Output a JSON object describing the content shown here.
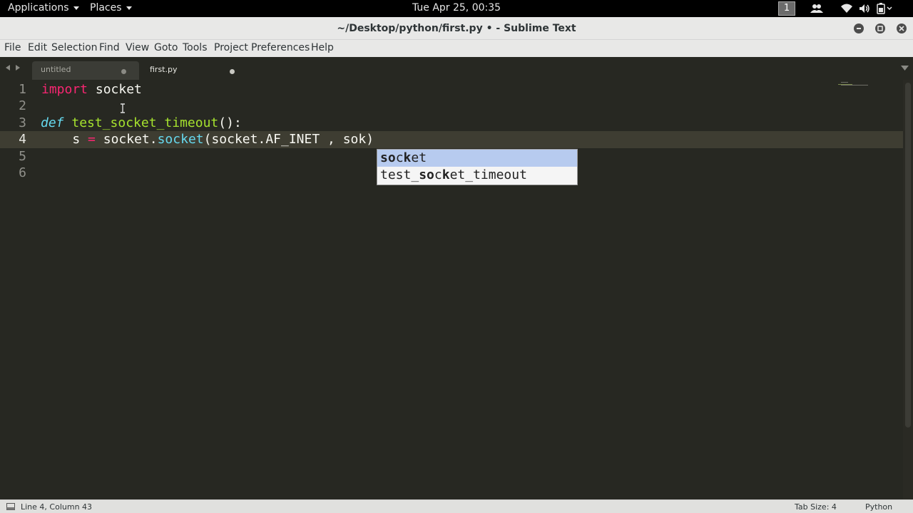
{
  "topbar": {
    "applications_label": "Applications",
    "places_label": "Places",
    "clock": "Tue Apr 25, 00:35",
    "workspace_number": "1"
  },
  "window": {
    "title": "~/Desktop/python/first.py • - Sublime Text"
  },
  "menu": {
    "items": [
      "File",
      "Edit",
      "Selection",
      "Find",
      "View",
      "Goto",
      "Tools",
      "Project",
      "Preferences",
      "Help"
    ]
  },
  "tabs": [
    {
      "label": "untitled",
      "active": false
    },
    {
      "label": "first.py",
      "active": true
    }
  ],
  "editor": {
    "line_numbers": [
      "1",
      "2",
      "3",
      "4",
      "5",
      "6"
    ],
    "active_line": 4,
    "line1": {
      "keyword": "import",
      "rest": " socket"
    },
    "line3": {
      "keyword": "def",
      "name": "test_socket_timeout",
      "rest": "():"
    },
    "line4": {
      "indent": "    ",
      "var": "s",
      "op": "=",
      "obj": "socket.",
      "call": "socket",
      "args": "(socket.AF_INET , sok)"
    }
  },
  "autocomplete": {
    "items": [
      {
        "text": "socket",
        "selected": true
      },
      {
        "text": "test_socket_timeout",
        "selected": false
      }
    ]
  },
  "status": {
    "position": "Line 4, Column 43",
    "tab_size": "Tab Size: 4",
    "syntax": "Python"
  },
  "colors": {
    "editor_bg": "#272822",
    "keyword": "#f92672",
    "storage": "#66d9ef",
    "function": "#a6e22e",
    "autocomplete_selected": "#b7cbef"
  }
}
